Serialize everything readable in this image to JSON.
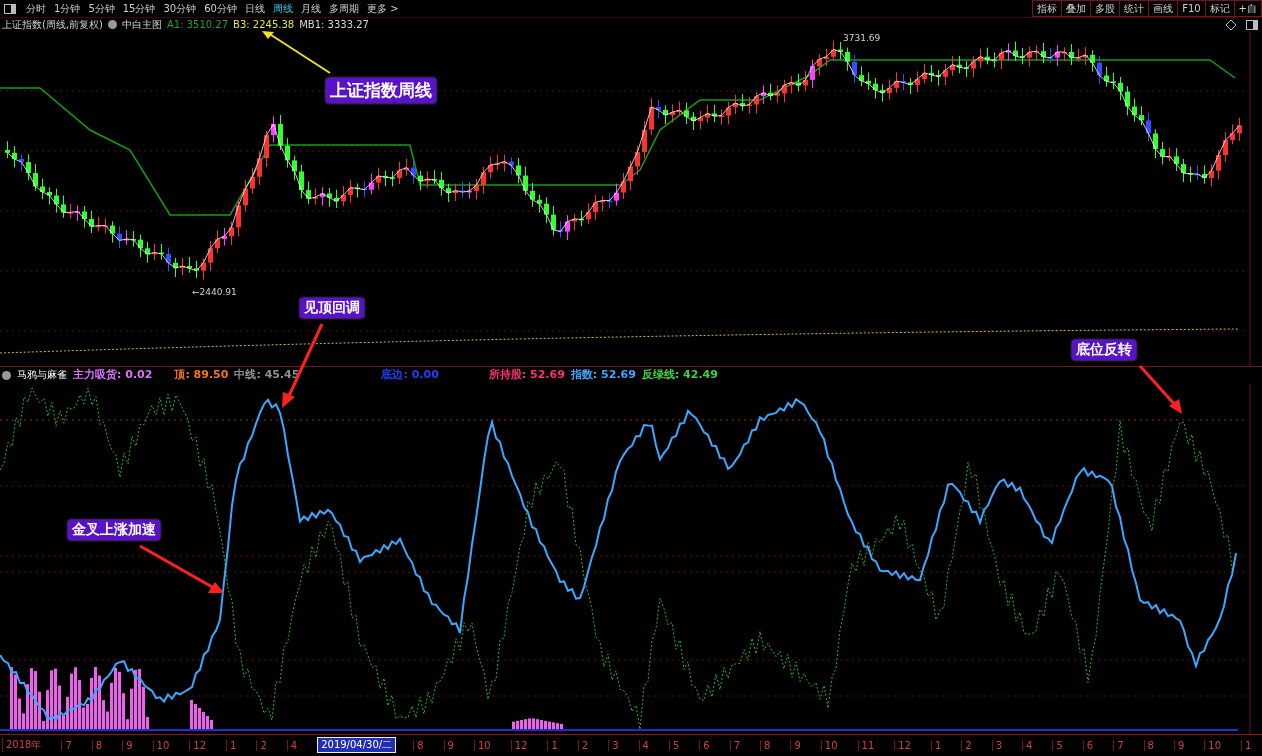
{
  "toolbar": {
    "periods": [
      {
        "label": "分时",
        "selected": false
      },
      {
        "label": "1分钟",
        "selected": false
      },
      {
        "label": "5分钟",
        "selected": false
      },
      {
        "label": "15分钟",
        "selected": false
      },
      {
        "label": "30分钟",
        "selected": false
      },
      {
        "label": "60分钟",
        "selected": false
      },
      {
        "label": "日线",
        "selected": false
      },
      {
        "label": "周线",
        "selected": true
      },
      {
        "label": "月线",
        "selected": false
      },
      {
        "label": "多周期",
        "selected": false
      },
      {
        "label": "更多 >",
        "selected": false
      }
    ],
    "tools": [
      "指标",
      "叠加",
      "多股",
      "统计",
      "画线",
      "F10",
      "标记",
      "+自"
    ]
  },
  "main_chart": {
    "title": "上证指数(周线,前复权)",
    "template": "中白主图",
    "values": [
      {
        "text": "A1: 3510.27",
        "color": "#1fa51f"
      },
      {
        "text": "B3: 2245.38",
        "color": "#e8e830"
      },
      {
        "text": "MB1: 3333.27",
        "color": "#d8d8d8"
      }
    ],
    "high_label": "3731.69",
    "low_label": "←2440.91"
  },
  "indicator": {
    "name": "马鸦与麻雀",
    "values": [
      {
        "text": "主力吸货: 0.02",
        "color": "#e070ff"
      },
      {
        "text": "顶: 89.50",
        "color": "#f07820"
      },
      {
        "text": "中线: 45.45",
        "color": "#909090"
      },
      {
        "text": "底边: 0.00",
        "color": "#2040ff"
      },
      {
        "text": "所持股: 52.69",
        "color": "#ff3070"
      },
      {
        "text": "指数: 52.69",
        "color": "#3aa8ff"
      },
      {
        "text": "反绿线: 42.49",
        "color": "#40d040"
      }
    ]
  },
  "annotations": [
    {
      "text": "上证指数周线"
    },
    {
      "text": "见顶回调"
    },
    {
      "text": "金叉上涨加速"
    },
    {
      "text": "底位反转"
    }
  ],
  "time_axis": [
    {
      "label": "2018年",
      "selected": false
    },
    {
      "label": "7",
      "selected": false
    },
    {
      "label": "8",
      "selected": false
    },
    {
      "label": "9",
      "selected": false
    },
    {
      "label": "10",
      "selected": false
    },
    {
      "label": "12",
      "selected": false
    },
    {
      "label": "1",
      "selected": false
    },
    {
      "label": "2",
      "selected": false
    },
    {
      "label": "4",
      "selected": false
    },
    {
      "label": "2019/04/30/二",
      "selected": true
    },
    {
      "label": "8",
      "selected": false
    },
    {
      "label": "9",
      "selected": false
    },
    {
      "label": "10",
      "selected": false
    },
    {
      "label": "12",
      "selected": false
    },
    {
      "label": "1",
      "selected": false
    },
    {
      "label": "2",
      "selected": false
    },
    {
      "label": "3",
      "selected": false
    },
    {
      "label": "4",
      "selected": false
    },
    {
      "label": "5",
      "selected": false
    },
    {
      "label": "6",
      "selected": false
    },
    {
      "label": "7",
      "selected": false
    },
    {
      "label": "8",
      "selected": false
    },
    {
      "label": "9",
      "selected": false
    },
    {
      "label": "10",
      "selected": false
    },
    {
      "label": "11",
      "selected": false
    },
    {
      "label": "12",
      "selected": false
    },
    {
      "label": "1",
      "selected": false
    },
    {
      "label": "2",
      "selected": false
    },
    {
      "label": "3",
      "selected": false
    },
    {
      "label": "4",
      "selected": false
    },
    {
      "label": "5",
      "selected": false
    },
    {
      "label": "6",
      "selected": false
    },
    {
      "label": "7",
      "selected": false
    },
    {
      "label": "8",
      "selected": false
    },
    {
      "label": "9",
      "selected": false
    },
    {
      "label": "10",
      "selected": false
    },
    {
      "label": "1",
      "selected": false
    }
  ]
}
